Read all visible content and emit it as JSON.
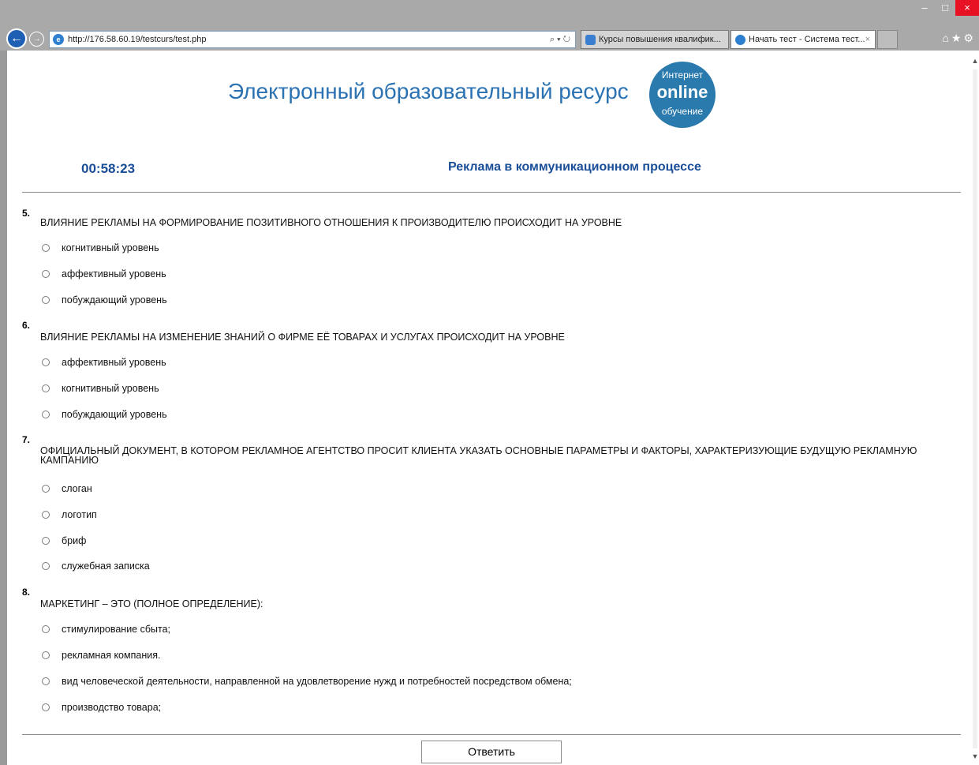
{
  "browser": {
    "url": "http://176.58.60.19/testcurs/test.php",
    "address_tools": "⌕ ▾ ↻",
    "tabs": [
      {
        "label": "Курсы повышения квалифик..."
      },
      {
        "label": "Начать тест - Система тест..."
      }
    ]
  },
  "header": {
    "title": "Электронный образовательный ресурс",
    "badge": {
      "line1": "Интернет",
      "line2": "online",
      "line3": "обучение"
    },
    "timer": "00:58:23",
    "course": "Реклама в коммуникационном процессе"
  },
  "questions": [
    {
      "number": "5.",
      "text": "ВЛИЯНИЕ РЕКЛАМЫ  НА ФОРМИРОВАНИЕ ПОЗИТИВНОГО ОТНОШЕНИЯ К ПРОИЗВОДИТЕЛЮ ПРОИСХОДИТ НА УРОВНЕ",
      "options": [
        "когнитивный уровень",
        "аффективный  уровень",
        "побуждающий уровень"
      ]
    },
    {
      "number": "6.",
      "text": "ВЛИЯНИЕ РЕКЛАМЫ  НА ИЗМЕНЕНИЕ ЗНАНИЙ О ФИРМЕ ЕЁ ТОВАРАХ И УСЛУГАХ ПРОИСХОДИТ НА УРОВНЕ",
      "options": [
        "аффективный  уровень",
        "когнитивный уровень",
        "побуждающий уровень"
      ]
    },
    {
      "number": "7.",
      "text": "ОФИЦИАЛЬНЫЙ ДОКУМЕНТ, В КОТОРОМ РЕКЛАМНОЕ АГЕНТСТВО ПРОСИТ КЛИЕНТА УКАЗАТЬ ОСНОВНЫЕ ПАРАМЕТРЫ И ФАКТОРЫ, ХАРАКТЕРИЗУЮЩИЕ БУДУЩУЮ РЕКЛАМНУЮ КАМПАНИЮ",
      "options": [
        "слоган",
        "логотип",
        "бриф",
        "служебная записка"
      ]
    },
    {
      "number": "8.",
      "text": "МАРКЕТИНГ – ЭТО (ПОЛНОЕ ОПРЕДЕЛЕНИЕ):",
      "options": [
        "стимулирование сбыта;",
        "рекламная компания.",
        "вид  человеческой деятельности, направленной на удовлетворение нужд и потребностей посредством обмена;",
        "производство товара;"
      ]
    }
  ],
  "submit_label": "Ответить"
}
